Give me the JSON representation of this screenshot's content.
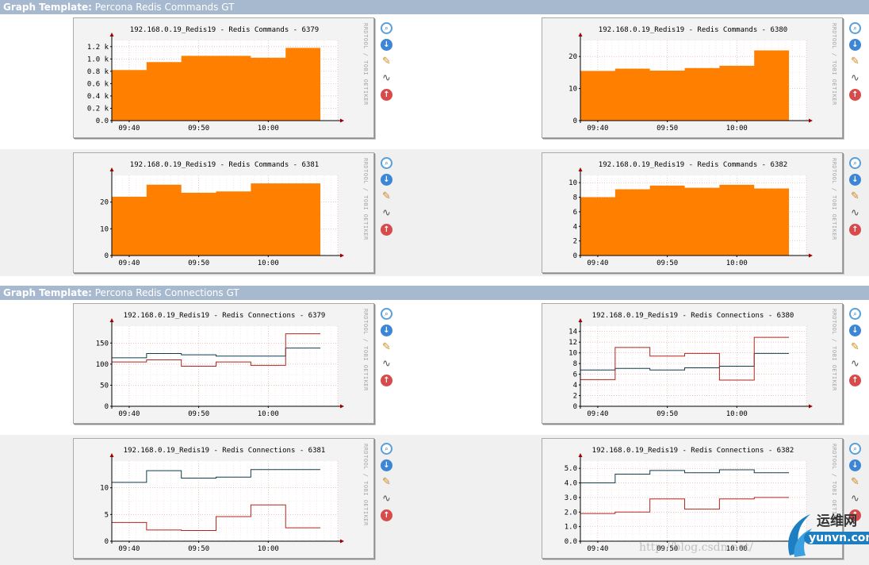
{
  "sections": [
    {
      "label": "Graph Template:",
      "name": "Percona Redis Commands GT"
    },
    {
      "label": "Graph Template:",
      "name": "Percona Redis Connections GT"
    }
  ],
  "side_text": "RRDTOOL / TOBI OETIKER",
  "icons": [
    "zoom-icon",
    "download-icon",
    "edit-icon",
    "graph-icon",
    "move-up-icon"
  ],
  "watermark": "http://blog.csdn.net/",
  "logo": {
    "cn": "运维网",
    "en": "yunvn.com"
  },
  "graphs": [
    {
      "title": "192.168.0.19_Redis19 - Redis Commands - 6379",
      "chart_data": {
        "type": "area",
        "ylim": [
          0,
          1300
        ],
        "yticks": [
          0,
          200,
          400,
          600,
          800,
          1000,
          1200
        ],
        "ytick_labels": [
          "0.0",
          "0.2 k",
          "0.4 k",
          "0.6 k",
          "0.8 k",
          "1.0 k",
          "1.2 k"
        ],
        "xtick_labels": [
          "09:40",
          "09:50",
          "10:00"
        ],
        "series": [
          {
            "color": "#ff7f00",
            "steps": [
              [
                "09:37:30",
                820
              ],
              [
                "09:42:30",
                950
              ],
              [
                "09:47:30",
                1050
              ],
              [
                "09:52:30",
                1050
              ],
              [
                "09:57:30",
                1020
              ],
              [
                "10:02:30",
                1180
              ],
              [
                "10:07:30",
                1180
              ]
            ]
          }
        ]
      }
    },
    {
      "title": "192.168.0.19_Redis19 - Redis Commands - 6380",
      "chart_data": {
        "type": "area",
        "ylim": [
          0,
          25
        ],
        "yticks": [
          0,
          10,
          20
        ],
        "ytick_labels": [
          "0",
          "10",
          "20"
        ],
        "xtick_labels": [
          "09:40",
          "09:50",
          "10:00"
        ],
        "series": [
          {
            "color": "#ff7f00",
            "steps": [
              [
                "09:37:30",
                15.5
              ],
              [
                "09:42:30",
                16.2
              ],
              [
                "09:47:30",
                15.6
              ],
              [
                "09:52:30",
                16.4
              ],
              [
                "09:57:30",
                17.1
              ],
              [
                "10:02:30",
                21.9
              ],
              [
                "10:07:30",
                21.9
              ]
            ]
          }
        ]
      }
    },
    {
      "title": "192.168.0.19_Redis19 - Redis Commands - 6381",
      "chart_data": {
        "type": "area",
        "ylim": [
          0,
          30
        ],
        "yticks": [
          0,
          10,
          20
        ],
        "ytick_labels": [
          "0",
          "10",
          "20"
        ],
        "xtick_labels": [
          "09:40",
          "09:50",
          "10:00"
        ],
        "series": [
          {
            "color": "#ff7f00",
            "steps": [
              [
                "09:37:30",
                22
              ],
              [
                "09:42:30",
                26.5
              ],
              [
                "09:47:30",
                23.5
              ],
              [
                "09:52:30",
                24
              ],
              [
                "09:57:30",
                27
              ],
              [
                "10:02:30",
                27
              ],
              [
                "10:07:30",
                27
              ]
            ]
          }
        ]
      }
    },
    {
      "title": "192.168.0.19_Redis19 - Redis Commands - 6382",
      "chart_data": {
        "type": "area",
        "ylim": [
          0,
          11
        ],
        "yticks": [
          0,
          2,
          4,
          6,
          8,
          10
        ],
        "ytick_labels": [
          "0",
          "2",
          "4",
          "6",
          "8",
          "10"
        ],
        "xtick_labels": [
          "09:40",
          "09:50",
          "10:00"
        ],
        "series": [
          {
            "color": "#ff7f00",
            "steps": [
              [
                "09:37:30",
                8
              ],
              [
                "09:42:30",
                9.1
              ],
              [
                "09:47:30",
                9.6
              ],
              [
                "09:52:30",
                9.3
              ],
              [
                "09:57:30",
                9.7
              ],
              [
                "10:02:30",
                9.2
              ],
              [
                "10:07:30",
                9.2
              ]
            ]
          }
        ]
      }
    },
    {
      "title": "192.168.0.19_Redis19 - Redis Connections - 6379",
      "chart_data": {
        "type": "line",
        "ylim": [
          0,
          190
        ],
        "yticks": [
          0,
          50,
          100,
          150
        ],
        "ytick_labels": [
          "0",
          "50",
          "100",
          "150"
        ],
        "xtick_labels": [
          "09:40",
          "09:50",
          "10:00"
        ],
        "series": [
          {
            "color": "#0f3f4f",
            "steps": [
              [
                "09:37:30",
                115
              ],
              [
                "09:42:30",
                125
              ],
              [
                "09:47:30",
                122
              ],
              [
                "09:52:30",
                119
              ],
              [
                "09:57:30",
                119
              ],
              [
                "10:02:30",
                138
              ],
              [
                "10:07:30",
                138
              ]
            ]
          },
          {
            "color": "#b3251c",
            "steps": [
              [
                "09:37:30",
                105
              ],
              [
                "09:42:30",
                110
              ],
              [
                "09:47:30",
                95
              ],
              [
                "09:52:30",
                105
              ],
              [
                "09:57:30",
                97
              ],
              [
                "10:02:30",
                172
              ],
              [
                "10:07:30",
                172
              ]
            ]
          }
        ]
      }
    },
    {
      "title": "192.168.0.19_Redis19 - Redis Connections - 6380",
      "chart_data": {
        "type": "line",
        "ylim": [
          0,
          15
        ],
        "yticks": [
          0,
          2,
          4,
          6,
          8,
          10,
          12,
          14
        ],
        "ytick_labels": [
          "0",
          "2",
          "4",
          "6",
          "8",
          "10",
          "12",
          "14"
        ],
        "xtick_labels": [
          "09:40",
          "09:50",
          "10:00"
        ],
        "series": [
          {
            "color": "#0f3f4f",
            "steps": [
              [
                "09:37:30",
                6.8
              ],
              [
                "09:42:30",
                7.1
              ],
              [
                "09:47:30",
                6.8
              ],
              [
                "09:52:30",
                7.2
              ],
              [
                "09:57:30",
                7.5
              ],
              [
                "10:02:30",
                9.9
              ],
              [
                "10:07:30",
                9.9
              ]
            ]
          },
          {
            "color": "#b3251c",
            "steps": [
              [
                "09:37:30",
                5
              ],
              [
                "09:42:30",
                11
              ],
              [
                "09:47:30",
                9.4
              ],
              [
                "09:52:30",
                9.9
              ],
              [
                "09:57:30",
                4.9
              ],
              [
                "10:02:30",
                12.9
              ],
              [
                "10:07:30",
                12.9
              ]
            ]
          }
        ]
      }
    },
    {
      "title": "192.168.0.19_Redis19 - Redis Connections - 6381",
      "chart_data": {
        "type": "line",
        "ylim": [
          0,
          15
        ],
        "yticks": [
          0,
          5,
          10
        ],
        "ytick_labels": [
          "0",
          "5",
          "10"
        ],
        "xtick_labels": [
          "09:40",
          "09:50",
          "10:00"
        ],
        "series": [
          {
            "color": "#0f3f4f",
            "steps": [
              [
                "09:37:30",
                11
              ],
              [
                "09:42:30",
                13.2
              ],
              [
                "09:47:30",
                11.8
              ],
              [
                "09:52:30",
                12
              ],
              [
                "09:57:30",
                13.4
              ],
              [
                "10:02:30",
                13.4
              ],
              [
                "10:07:30",
                13.4
              ]
            ]
          },
          {
            "color": "#b3251c",
            "steps": [
              [
                "09:37:30",
                3.5
              ],
              [
                "09:42:30",
                2.1
              ],
              [
                "09:47:30",
                2
              ],
              [
                "09:52:30",
                4.6
              ],
              [
                "09:57:30",
                6.8
              ],
              [
                "10:02:30",
                2.5
              ],
              [
                "10:07:30",
                2.5
              ]
            ]
          }
        ]
      }
    },
    {
      "title": "192.168.0.19_Redis19 - Redis Connections - 6382",
      "chart_data": {
        "type": "line",
        "ylim": [
          0,
          5.5
        ],
        "yticks": [
          0,
          1,
          2,
          3,
          4,
          5
        ],
        "ytick_labels": [
          "0.0",
          "1.0",
          "2.0",
          "3.0",
          "4.0",
          "5.0"
        ],
        "xtick_labels": [
          "09:40",
          "09:50",
          "10:00"
        ],
        "series": [
          {
            "color": "#0f3f4f",
            "steps": [
              [
                "09:37:30",
                4
              ],
              [
                "09:42:30",
                4.6
              ],
              [
                "09:47:30",
                4.85
              ],
              [
                "09:52:30",
                4.7
              ],
              [
                "09:57:30",
                4.9
              ],
              [
                "10:02:30",
                4.7
              ],
              [
                "10:07:30",
                4.7
              ]
            ]
          },
          {
            "color": "#b3251c",
            "steps": [
              [
                "09:37:30",
                1.9
              ],
              [
                "09:42:30",
                2.0
              ],
              [
                "09:47:30",
                2.9
              ],
              [
                "09:52:30",
                2.2
              ],
              [
                "09:57:30",
                2.9
              ],
              [
                "10:02:30",
                3.0
              ],
              [
                "10:07:30",
                3.0
              ]
            ]
          }
        ]
      }
    }
  ]
}
